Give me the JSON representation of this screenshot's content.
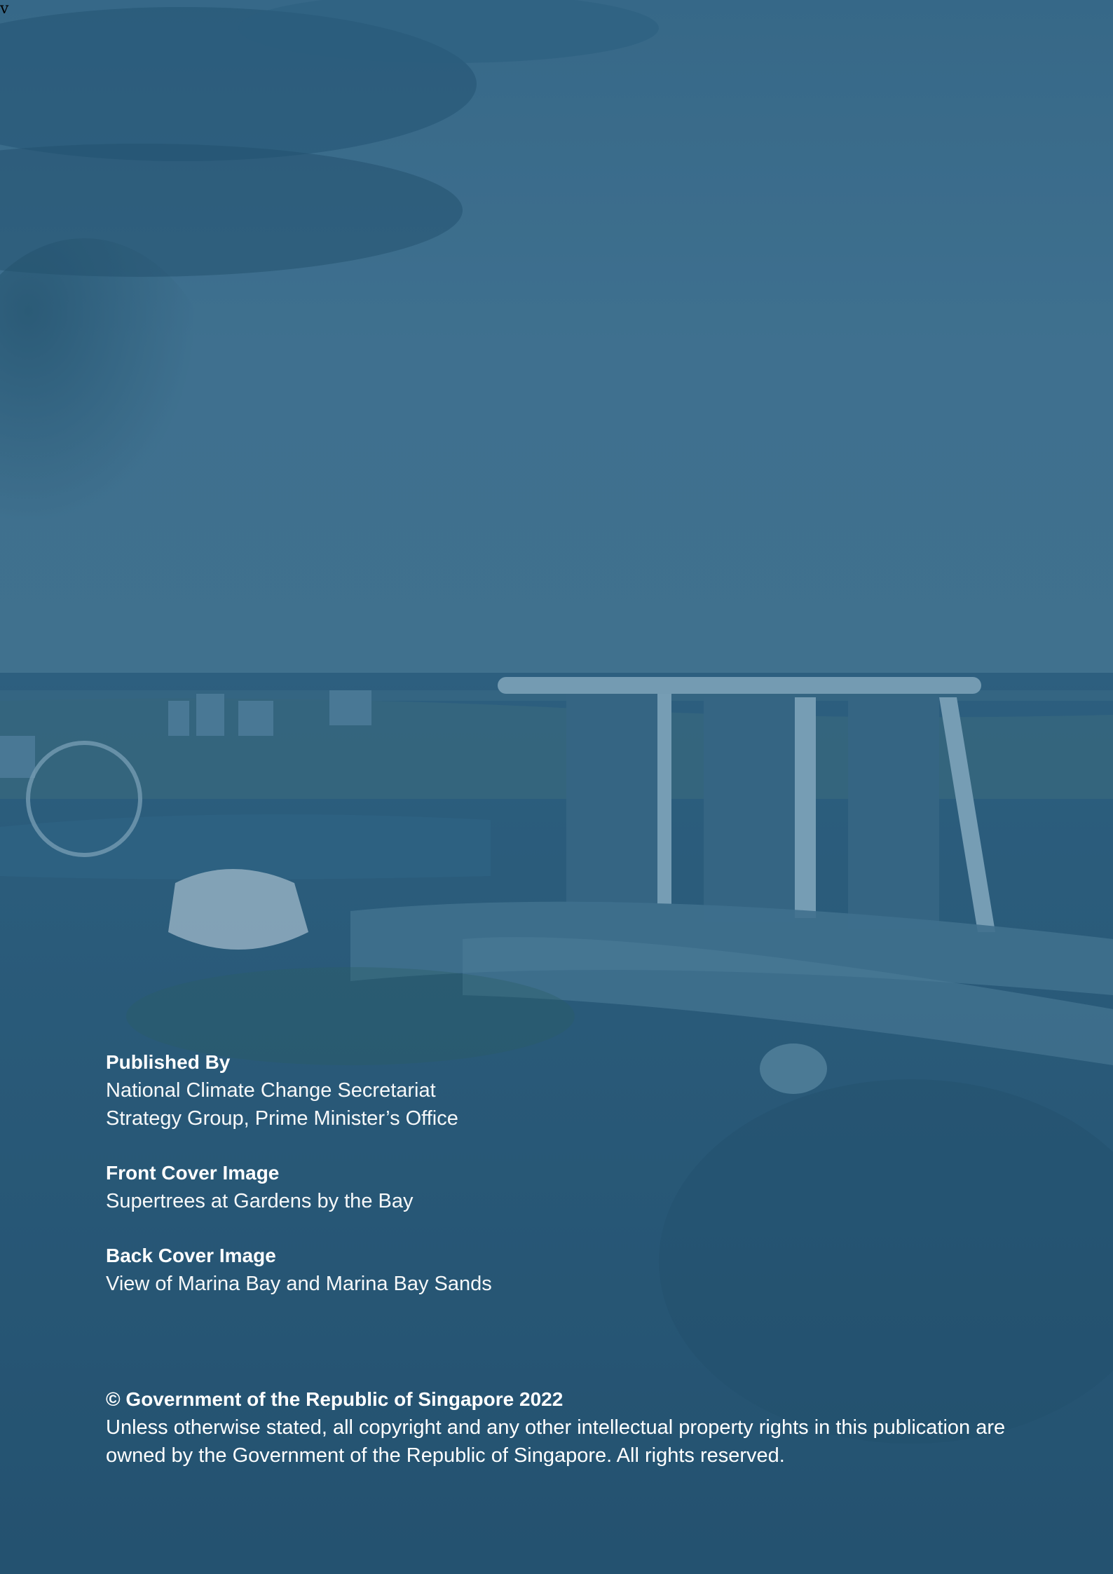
{
  "page": {
    "corner_mark": "v"
  },
  "credits": {
    "published_by": {
      "heading": "Published By",
      "lines": [
        "National Climate Change Secretariat",
        "Strategy Group, Prime Minister’s Office"
      ]
    },
    "front_cover": {
      "heading": "Front Cover Image",
      "lines": [
        "Supertrees at Gardens by the Bay"
      ]
    },
    "back_cover": {
      "heading": "Back Cover Image",
      "lines": [
        "View of Marina Bay and Marina Bay Sands"
      ]
    }
  },
  "copyright": {
    "heading": "© Government of the Republic of Singapore 2022",
    "lines": [
      "Unless otherwise stated, all copyright and any other intellectual property rights in this publication are",
      "owned by the Government of the Republic of Singapore. All rights reserved."
    ]
  },
  "colors": {
    "overlay": "#2f5f7e",
    "sky": "#4a7a98",
    "water": "#285a78",
    "text": "#ffffff"
  }
}
